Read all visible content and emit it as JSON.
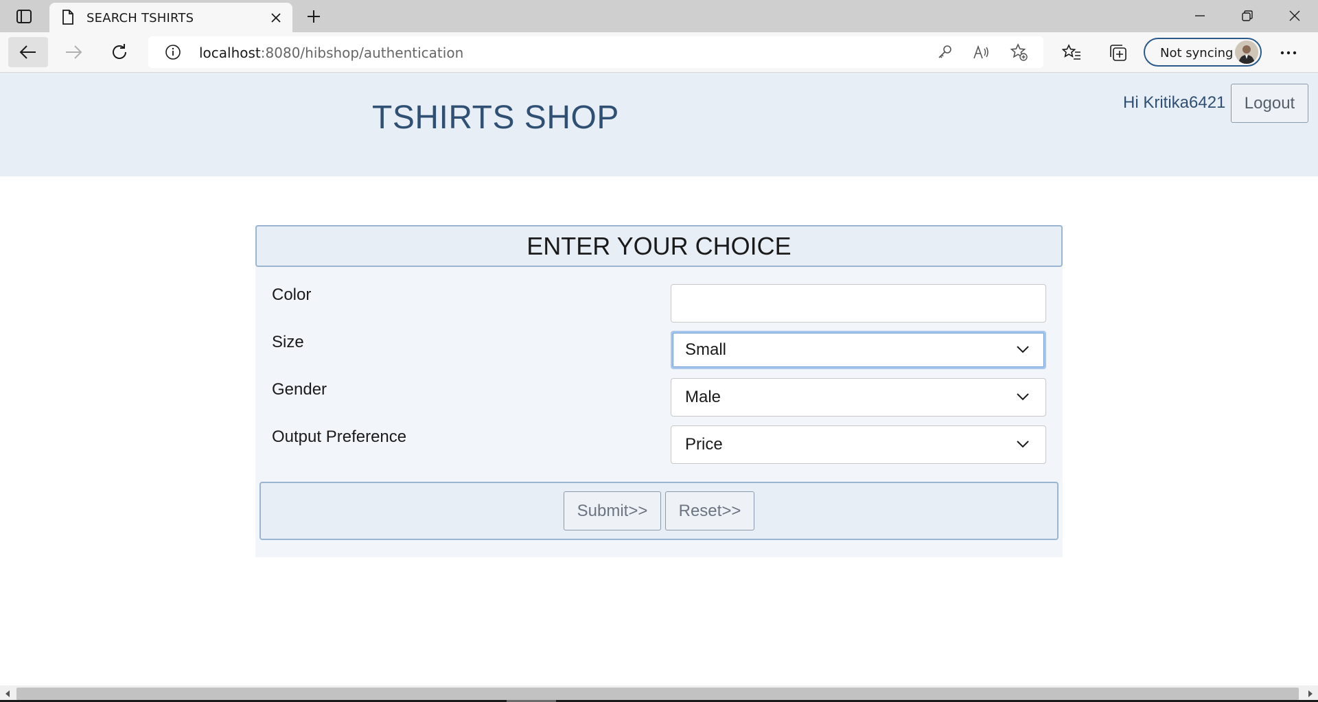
{
  "browser": {
    "tab_title": "SEARCH TSHIRTS",
    "url_host": "localhost",
    "url_rest": ":8080/hibshop/authentication",
    "sync_label": "Not syncing"
  },
  "header": {
    "title": "TSHIRTS SHOP",
    "greeting": "Hi Kritika6421",
    "logout_label": "Logout"
  },
  "form": {
    "title": "ENTER YOUR CHOICE",
    "fields": [
      {
        "label": "Color",
        "value": ""
      },
      {
        "label": "Size",
        "value": "Small"
      },
      {
        "label": "Gender",
        "value": "Male"
      },
      {
        "label": "Output Preference",
        "value": "Price"
      }
    ],
    "submit_label": "Submit>>",
    "reset_label": "Reset>>"
  },
  "colors": {
    "header_bg": "#e8eef6",
    "title_color": "#2f4f73",
    "panel_border": "#9ab5d2",
    "focus_ring": "#6f9fd8"
  }
}
